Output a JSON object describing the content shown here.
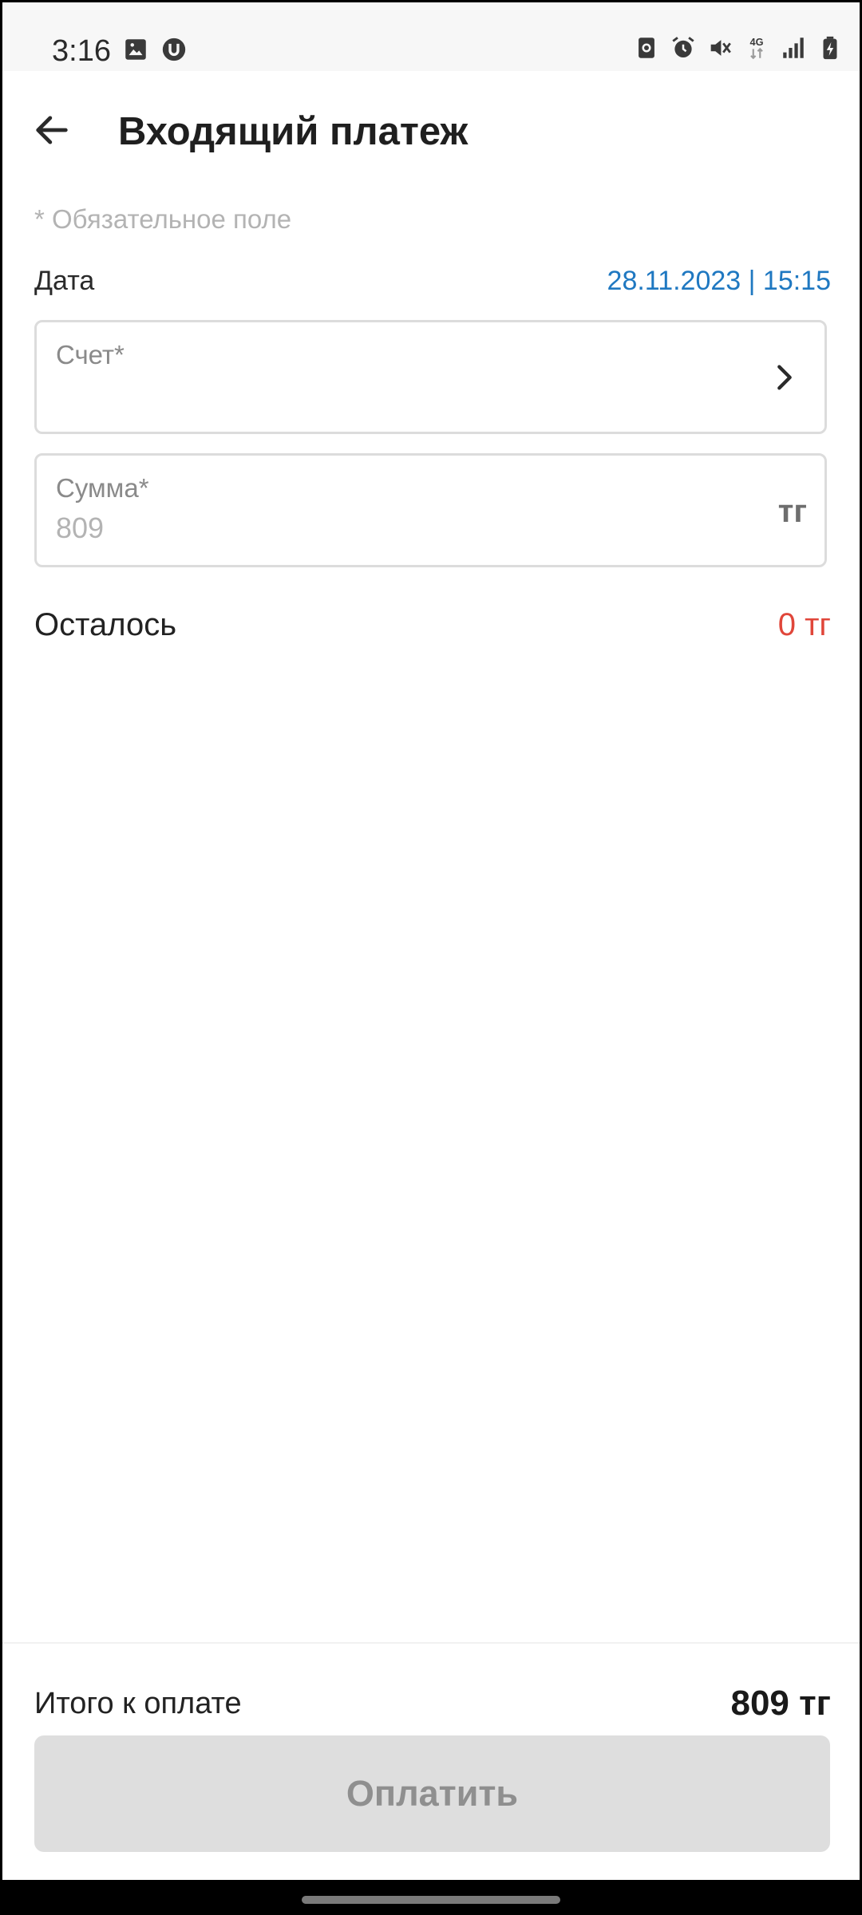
{
  "status_bar": {
    "time": "3:16",
    "left_icons": [
      "gallery-icon",
      "app-u-icon"
    ],
    "right_icons": [
      "backup-icon",
      "alarm-icon",
      "mute-icon",
      "network-4g-icon",
      "signal-icon",
      "battery-icon"
    ],
    "network_label": "4G"
  },
  "header": {
    "title": "Входящий платеж"
  },
  "form": {
    "required_note": "* Обязательное поле",
    "date_label": "Дата",
    "date_value": "28.11.2023 | 15:15",
    "account_label": "Счет*",
    "sum_label": "Сумма*",
    "sum_value": "809",
    "sum_currency": "тг",
    "remain_label": "Осталось",
    "remain_value": "0 тг"
  },
  "footer": {
    "total_label": "Итого к оплате",
    "total_value": "809 тг",
    "pay_button": "Оплатить"
  },
  "colors": {
    "accent_blue": "#1f78c1",
    "remain_red": "#e0463a",
    "disabled_button": "#dedede"
  }
}
